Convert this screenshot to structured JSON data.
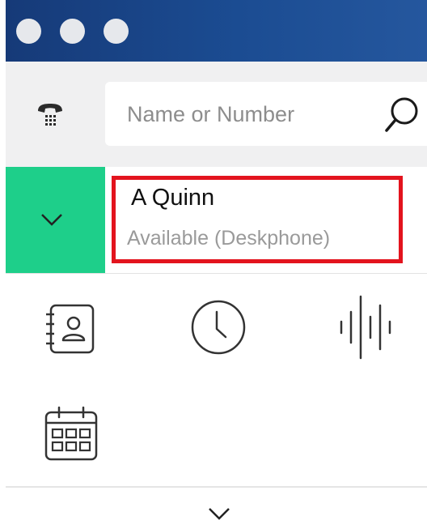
{
  "window": {
    "controls": [
      "close",
      "minimize",
      "maximize"
    ]
  },
  "search": {
    "placeholder": "Name or Number",
    "value": ""
  },
  "user": {
    "name": "A Quinn",
    "status": "Available (Deskphone)"
  },
  "nav": {
    "icons": [
      "contacts-icon",
      "recent-calls-clock-icon",
      "voicemail-waveform-icon",
      "calendar-icon"
    ]
  },
  "colors": {
    "titlebar": "#1b4c92",
    "accent_green": "#1ecf8a",
    "highlight_red": "#e3141e",
    "status_gray": "#9a9a9a",
    "icon_dark": "#333333"
  }
}
